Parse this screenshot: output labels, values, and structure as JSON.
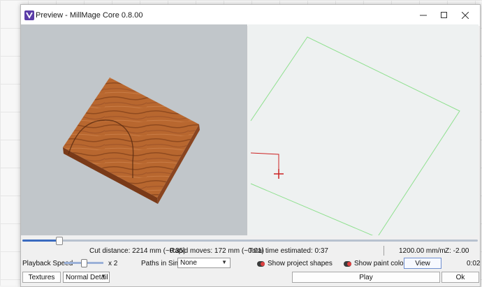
{
  "window": {
    "title": "Preview - MillMage Core 0.8.00",
    "minimize_icon": "minimize-icon",
    "maximize_icon": "maximize-icon",
    "close_icon": "close-icon"
  },
  "simulation": {
    "cut_distance": "Cut distance: 2214 mm (~0:35)",
    "rapid_moves": "Rapid moves: 172 mm (~0:01)",
    "total_time": "Total time estimated: 0:37",
    "feed_rate": "1200.00 mm/m",
    "z_position": "Z: -2.00",
    "progress_fraction": 0.08
  },
  "controls": {
    "playback_speed_label": "Playback Speed",
    "playback_speed_value": "x 2",
    "paths_in_sim_label": "Paths in Sim:",
    "paths_in_sim_value": "None",
    "show_project_shapes_label": "Show project shapes",
    "show_paint_colors_label": "Show paint colors",
    "view_button": "View",
    "elapsed_time": "0:02",
    "textures_button": "Textures",
    "detail_value": "Normal Detail",
    "play_button": "Play",
    "ok_button": "Ok"
  },
  "colors": {
    "accent": "#3a6bc0",
    "toolpath_green": "#7ddc7d",
    "tool_red": "#cc2222",
    "wood": "#b5652f"
  }
}
